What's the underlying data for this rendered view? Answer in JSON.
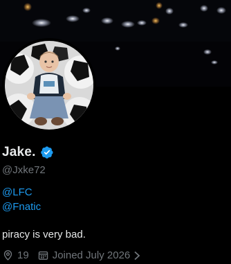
{
  "profile": {
    "display_name": "Jake.",
    "handle": "@Jxke72",
    "bio_links": [
      "@LFC",
      "@Fnatic"
    ],
    "bio_text": "piracy is very bad.",
    "location": "19",
    "joined": "Joined July 2026"
  },
  "colors": {
    "background": "#000000",
    "text": "#e7e9ea",
    "muted": "#71767b",
    "link": "#1d9bf0",
    "verified": "#1d9bf0"
  },
  "icons": [
    "verified-badge-icon",
    "location-pin-icon",
    "calendar-icon",
    "chevron-right-icon"
  ]
}
